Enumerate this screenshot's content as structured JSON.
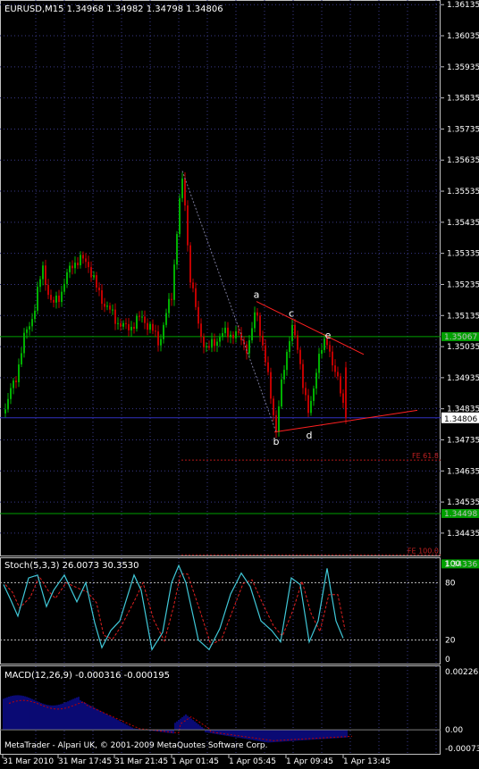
{
  "chart_data": [
    {
      "type": "candlestick",
      "title": "EURUSD,M15  1.34968 1.34982 1.34798 1.34806",
      "symbol": "EURUSD",
      "timeframe": "M15",
      "ohlc_last": {
        "open": 1.34968,
        "high": 1.34982,
        "low": 1.34798,
        "close": 1.34806
      },
      "ylim": [
        1.3436,
        1.3615
      ],
      "y_ticks": [
        "1.36135",
        "1.36035",
        "1.35935",
        "1.35835",
        "1.35735",
        "1.35635",
        "1.35535",
        "1.35435",
        "1.35335",
        "1.35235",
        "1.35135",
        "1.35035",
        "1.34935",
        "1.34835",
        "1.34735",
        "1.34635",
        "1.34535",
        "1.34435"
      ],
      "current_price_label": "1.34806",
      "hlines": [
        {
          "label": "1.35067",
          "value": 1.35067,
          "color": "#00a000"
        },
        {
          "label": "1.34806",
          "value": 1.34806,
          "color": "#3030c0"
        },
        {
          "label": "1.34498",
          "value": 1.34498,
          "color": "#00a000"
        },
        {
          "label": "1.34336",
          "value": 1.34336,
          "color": "#00a000"
        }
      ],
      "fe_lines": [
        {
          "label": "FE 61.8",
          "value": 1.3467
        },
        {
          "label": "FE 100.0",
          "value": 1.34365
        }
      ],
      "pattern_points": [
        {
          "label": "a",
          "x": 287,
          "y": 1.3518
        },
        {
          "label": "b",
          "x": 309,
          "y": 1.3476
        },
        {
          "label": "c",
          "x": 326,
          "y": 1.3512
        },
        {
          "label": "d",
          "x": 346,
          "y": 1.3478
        },
        {
          "label": "e",
          "x": 367,
          "y": 1.3505
        }
      ],
      "bull_color": "#00b000",
      "bear_color": "#c00000"
    },
    {
      "type": "line",
      "title": "Stoch(5,3,3) 26.0073 30.3530",
      "values_main": 26.0073,
      "values_signal": 30.353,
      "ylim": [
        0,
        100
      ],
      "y_ticks": [
        "100",
        "80",
        "20",
        "0"
      ],
      "levels": [
        80,
        20
      ],
      "series": [
        {
          "name": "main",
          "color": "#40c8d8"
        },
        {
          "name": "signal",
          "color": "#e02020"
        }
      ]
    },
    {
      "type": "bar",
      "title": "MACD(12,26,9) -0.000316 -0.000195",
      "macd_value": -0.000316,
      "signal_value": -0.000195,
      "ylim": [
        -0.00073,
        0.00227
      ],
      "y_ticks": [
        "0.002267",
        "0.00",
        "-0.00073"
      ],
      "histogram_color": "#1010c0",
      "signal_color": "#c00000"
    }
  ],
  "x_labels": [
    "31 Mar 2010",
    "31 Mar 17:45",
    "31 Mar 21:45",
    "1 Apr 01:45",
    "1 Apr 05:45",
    "1 Apr 09:45",
    "1 Apr 13:45"
  ],
  "copyright": "MetaTrader - Alpari UK, © 2001-2009 MetaQuotes Software Corp."
}
